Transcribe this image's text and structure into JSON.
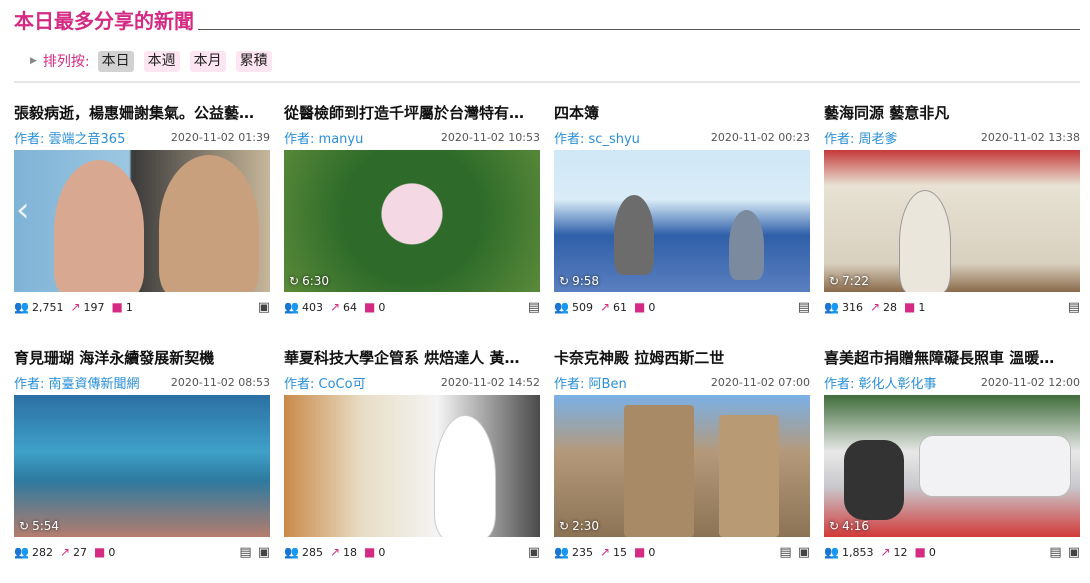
{
  "header": {
    "title": "本日最多分享的新聞"
  },
  "sort": {
    "label": "排列按:",
    "options": [
      "本日",
      "本週",
      "本月",
      "累積"
    ],
    "active": 0
  },
  "colors": {
    "accent": "#d42a83",
    "link": "#2a8fd6"
  },
  "icons": {
    "views": "people-icon",
    "shares": "share-icon",
    "comments": "comment-icon",
    "video": "video-icon",
    "gallery": "gallery-icon",
    "duration": "replay-clock-icon"
  },
  "author_prefix": "作者:",
  "articles": [
    {
      "title": "張毅病逝，楊惠姍謝集氣。公益藝…",
      "author": "雲端之音365",
      "date": "2020-11-02 01:39",
      "duration": "",
      "views": "2,751",
      "shares": "197",
      "comments": "1"
    },
    {
      "title": "從醫檢師到打造千坪屬於台灣特有…",
      "author": "manyu",
      "date": "2020-11-02 10:53",
      "duration": "6:30",
      "views": "403",
      "shares": "64",
      "comments": "0"
    },
    {
      "title": "四本簿",
      "author": "sc_shyu",
      "date": "2020-11-02 00:23",
      "duration": "9:58",
      "views": "509",
      "shares": "61",
      "comments": "0"
    },
    {
      "title": "藝海同源 藝意非凡",
      "author": "周老爹",
      "date": "2020-11-02 13:38",
      "duration": "7:22",
      "views": "316",
      "shares": "28",
      "comments": "1"
    },
    {
      "title": "育見珊瑚 海洋永續發展新契機",
      "author": "南臺資傳新聞網",
      "date": "2020-11-02 08:53",
      "duration": "5:54",
      "views": "282",
      "shares": "27",
      "comments": "0"
    },
    {
      "title": "華夏科技大學企管系 烘焙達人 黃…",
      "author": "CoCo可",
      "date": "2020-11-02 14:52",
      "duration": "",
      "views": "285",
      "shares": "18",
      "comments": "0"
    },
    {
      "title": "卡奈克神殿 拉姆西斯二世",
      "author": "阿Ben",
      "date": "2020-11-02 07:00",
      "duration": "2:30",
      "views": "235",
      "shares": "15",
      "comments": "0"
    },
    {
      "title": "喜美超市捐贈無障礙長照車 溫暖…",
      "author": "彰化人彰化事",
      "date": "2020-11-02 12:00",
      "duration": "4:16",
      "views": "1,853",
      "shares": "12",
      "comments": "0"
    }
  ]
}
